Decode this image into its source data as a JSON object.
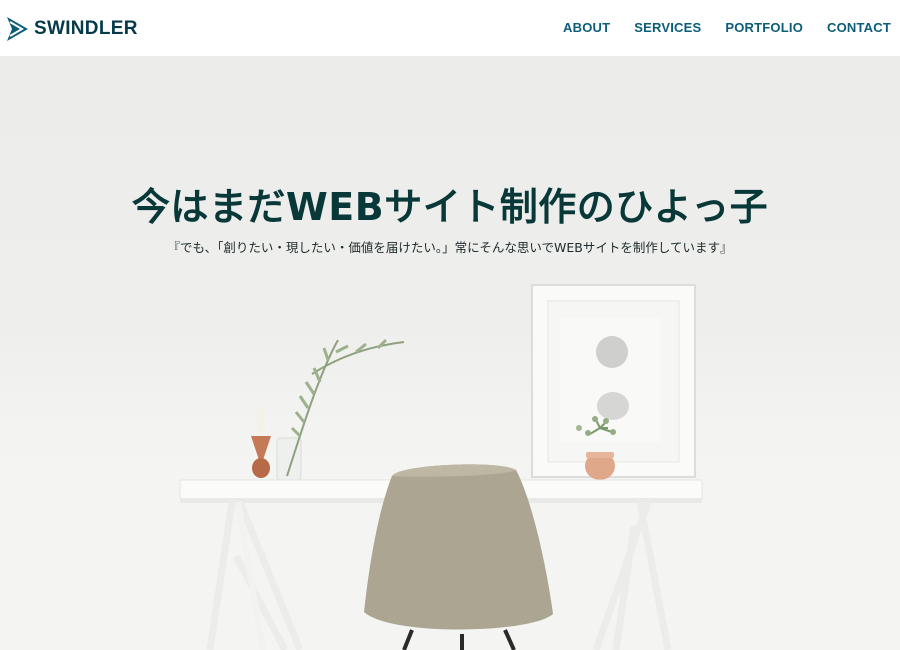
{
  "logo": {
    "text": "SWINDLER",
    "icon": "chevron-arrow-logo-icon",
    "color": "#063a4a"
  },
  "nav": {
    "items": [
      {
        "label": "ABOUT"
      },
      {
        "label": "SERVICES"
      },
      {
        "label": "PORTFOLIO"
      },
      {
        "label": "CONTACT"
      }
    ],
    "color": "#0b5d78"
  },
  "hero": {
    "title": "今はまだWEBサイト制作のひよっ子",
    "subtitle": "『でも、「創りたい・現したい・価値を届けたい。」常にそんな思いでWEBサイトを制作しています』",
    "title_color": "#083838"
  }
}
